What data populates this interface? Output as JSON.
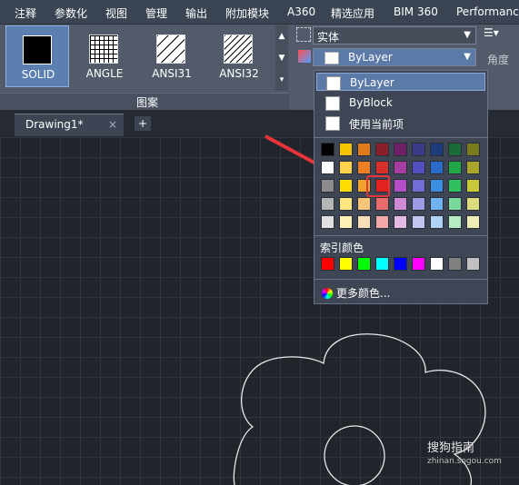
{
  "menubar": {
    "items": [
      "注释",
      "参数化",
      "视图",
      "管理",
      "输出",
      "附加模块",
      "A360",
      "精选应用",
      "BIM 360",
      "Performance"
    ]
  },
  "ribbon": {
    "patterns": [
      {
        "label": "SOLID",
        "selected": true
      },
      {
        "label": "ANGLE",
        "selected": false
      },
      {
        "label": "ANSI31",
        "selected": false
      },
      {
        "label": "ANSI32",
        "selected": false
      }
    ],
    "panel_label": "图案",
    "pattern_type_value": "实体",
    "color_value": "ByLayer",
    "angle_label": "角度"
  },
  "tabs": {
    "drawing_label": "Drawing1*",
    "close_glyph": "×",
    "add_glyph": "+"
  },
  "color_popup": {
    "options": [
      {
        "label": "ByLayer",
        "highlighted": true
      },
      {
        "label": "ByBlock",
        "highlighted": false
      },
      {
        "label": "使用当前项",
        "highlighted": false
      }
    ],
    "palette_rows": [
      [
        "#000000",
        "#f5c400",
        "#e07a1a",
        "#8a1f2b",
        "#6e2167",
        "#3b3b8a",
        "#1f3c7a",
        "#1b6b3a",
        "#7a7a1e"
      ],
      [
        "#ffffff",
        "#ffd34d",
        "#ef7d23",
        "#d7302a",
        "#a63da0",
        "#5250c0",
        "#2a6ac8",
        "#1fa845",
        "#a7a52a"
      ],
      [
        "#8c8c8c",
        "#ffde00",
        "#f2a32e",
        "#e32222",
        "#b44fc8",
        "#6f6fd6",
        "#3b8ee0",
        "#2fc060",
        "#c8c83a"
      ],
      [
        "#b5b5b5",
        "#ffe680",
        "#f7c47a",
        "#ea6d6d",
        "#d08ad8",
        "#9b9be6",
        "#6fb4f0",
        "#7ad99a",
        "#dcdc7d"
      ],
      [
        "#e0e0e0",
        "#fff2b8",
        "#fadcb8",
        "#f2a8a8",
        "#e3b9e6",
        "#c4c4f0",
        "#aed3f6",
        "#b5ecc3",
        "#ededb5"
      ]
    ],
    "index_color_label": "索引颜色",
    "index_colors": [
      "#ff0000",
      "#ffff00",
      "#00ff00",
      "#00ffff",
      "#0000ff",
      "#ff00ff",
      "#ffffff",
      "#808080",
      "#c0c0c0"
    ],
    "more_colors_label": "更多颜色..."
  },
  "annotation": {
    "arrow_color": "#e8333a"
  },
  "watermark": {
    "line1": "搜狗指南",
    "line2": "zhinan.sogou.com"
  }
}
